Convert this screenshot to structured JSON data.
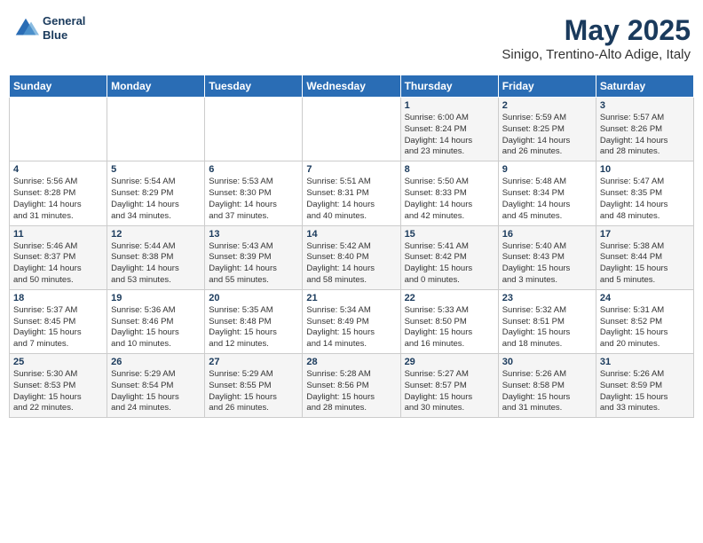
{
  "header": {
    "logo_line1": "General",
    "logo_line2": "Blue",
    "title": "May 2025",
    "subtitle": "Sinigo, Trentino-Alto Adige, Italy"
  },
  "weekdays": [
    "Sunday",
    "Monday",
    "Tuesday",
    "Wednesday",
    "Thursday",
    "Friday",
    "Saturday"
  ],
  "weeks": [
    [
      {
        "day": "",
        "info": ""
      },
      {
        "day": "",
        "info": ""
      },
      {
        "day": "",
        "info": ""
      },
      {
        "day": "",
        "info": ""
      },
      {
        "day": "1",
        "info": "Sunrise: 6:00 AM\nSunset: 8:24 PM\nDaylight: 14 hours\nand 23 minutes."
      },
      {
        "day": "2",
        "info": "Sunrise: 5:59 AM\nSunset: 8:25 PM\nDaylight: 14 hours\nand 26 minutes."
      },
      {
        "day": "3",
        "info": "Sunrise: 5:57 AM\nSunset: 8:26 PM\nDaylight: 14 hours\nand 28 minutes."
      }
    ],
    [
      {
        "day": "4",
        "info": "Sunrise: 5:56 AM\nSunset: 8:28 PM\nDaylight: 14 hours\nand 31 minutes."
      },
      {
        "day": "5",
        "info": "Sunrise: 5:54 AM\nSunset: 8:29 PM\nDaylight: 14 hours\nand 34 minutes."
      },
      {
        "day": "6",
        "info": "Sunrise: 5:53 AM\nSunset: 8:30 PM\nDaylight: 14 hours\nand 37 minutes."
      },
      {
        "day": "7",
        "info": "Sunrise: 5:51 AM\nSunset: 8:31 PM\nDaylight: 14 hours\nand 40 minutes."
      },
      {
        "day": "8",
        "info": "Sunrise: 5:50 AM\nSunset: 8:33 PM\nDaylight: 14 hours\nand 42 minutes."
      },
      {
        "day": "9",
        "info": "Sunrise: 5:48 AM\nSunset: 8:34 PM\nDaylight: 14 hours\nand 45 minutes."
      },
      {
        "day": "10",
        "info": "Sunrise: 5:47 AM\nSunset: 8:35 PM\nDaylight: 14 hours\nand 48 minutes."
      }
    ],
    [
      {
        "day": "11",
        "info": "Sunrise: 5:46 AM\nSunset: 8:37 PM\nDaylight: 14 hours\nand 50 minutes."
      },
      {
        "day": "12",
        "info": "Sunrise: 5:44 AM\nSunset: 8:38 PM\nDaylight: 14 hours\nand 53 minutes."
      },
      {
        "day": "13",
        "info": "Sunrise: 5:43 AM\nSunset: 8:39 PM\nDaylight: 14 hours\nand 55 minutes."
      },
      {
        "day": "14",
        "info": "Sunrise: 5:42 AM\nSunset: 8:40 PM\nDaylight: 14 hours\nand 58 minutes."
      },
      {
        "day": "15",
        "info": "Sunrise: 5:41 AM\nSunset: 8:42 PM\nDaylight: 15 hours\nand 0 minutes."
      },
      {
        "day": "16",
        "info": "Sunrise: 5:40 AM\nSunset: 8:43 PM\nDaylight: 15 hours\nand 3 minutes."
      },
      {
        "day": "17",
        "info": "Sunrise: 5:38 AM\nSunset: 8:44 PM\nDaylight: 15 hours\nand 5 minutes."
      }
    ],
    [
      {
        "day": "18",
        "info": "Sunrise: 5:37 AM\nSunset: 8:45 PM\nDaylight: 15 hours\nand 7 minutes."
      },
      {
        "day": "19",
        "info": "Sunrise: 5:36 AM\nSunset: 8:46 PM\nDaylight: 15 hours\nand 10 minutes."
      },
      {
        "day": "20",
        "info": "Sunrise: 5:35 AM\nSunset: 8:48 PM\nDaylight: 15 hours\nand 12 minutes."
      },
      {
        "day": "21",
        "info": "Sunrise: 5:34 AM\nSunset: 8:49 PM\nDaylight: 15 hours\nand 14 minutes."
      },
      {
        "day": "22",
        "info": "Sunrise: 5:33 AM\nSunset: 8:50 PM\nDaylight: 15 hours\nand 16 minutes."
      },
      {
        "day": "23",
        "info": "Sunrise: 5:32 AM\nSunset: 8:51 PM\nDaylight: 15 hours\nand 18 minutes."
      },
      {
        "day": "24",
        "info": "Sunrise: 5:31 AM\nSunset: 8:52 PM\nDaylight: 15 hours\nand 20 minutes."
      }
    ],
    [
      {
        "day": "25",
        "info": "Sunrise: 5:30 AM\nSunset: 8:53 PM\nDaylight: 15 hours\nand 22 minutes."
      },
      {
        "day": "26",
        "info": "Sunrise: 5:29 AM\nSunset: 8:54 PM\nDaylight: 15 hours\nand 24 minutes."
      },
      {
        "day": "27",
        "info": "Sunrise: 5:29 AM\nSunset: 8:55 PM\nDaylight: 15 hours\nand 26 minutes."
      },
      {
        "day": "28",
        "info": "Sunrise: 5:28 AM\nSunset: 8:56 PM\nDaylight: 15 hours\nand 28 minutes."
      },
      {
        "day": "29",
        "info": "Sunrise: 5:27 AM\nSunset: 8:57 PM\nDaylight: 15 hours\nand 30 minutes."
      },
      {
        "day": "30",
        "info": "Sunrise: 5:26 AM\nSunset: 8:58 PM\nDaylight: 15 hours\nand 31 minutes."
      },
      {
        "day": "31",
        "info": "Sunrise: 5:26 AM\nSunset: 8:59 PM\nDaylight: 15 hours\nand 33 minutes."
      }
    ]
  ]
}
